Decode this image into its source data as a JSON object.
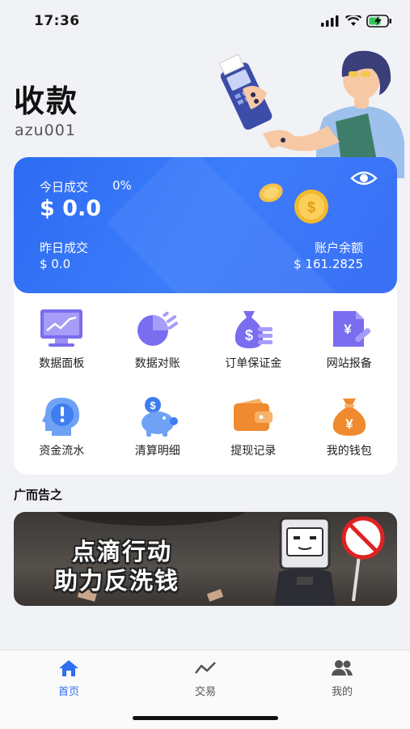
{
  "status_bar": {
    "time": "17:36"
  },
  "header": {
    "title": "收款",
    "username": "azu001"
  },
  "summary": {
    "today_label": "今日成交",
    "today_percent": "0%",
    "today_amount": "$ 0.0",
    "yesterday_label": "昨日成交",
    "yesterday_amount": "$ 0.0",
    "balance_label": "账户余额",
    "balance_amount": "$ 161.2825"
  },
  "menu": {
    "items": [
      {
        "label": "数据面板",
        "icon": "monitor-chart-icon"
      },
      {
        "label": "数据对账",
        "icon": "pie-chart-icon"
      },
      {
        "label": "订单保证金",
        "icon": "money-bag-icon"
      },
      {
        "label": "网站报备",
        "icon": "document-yen-icon"
      },
      {
        "label": "资金流水",
        "icon": "head-alert-icon"
      },
      {
        "label": "清算明细",
        "icon": "piggy-bank-icon"
      },
      {
        "label": "提现记录",
        "icon": "wallet-icon"
      },
      {
        "label": "我的钱包",
        "icon": "yen-bag-icon"
      }
    ]
  },
  "ads": {
    "title": "广而告之",
    "banner_line1": "点滴行动",
    "banner_line2": "助力反洗钱"
  },
  "tabs": [
    {
      "label": "首页",
      "icon": "home-icon",
      "active": true
    },
    {
      "label": "交易",
      "icon": "trend-icon",
      "active": false
    },
    {
      "label": "我的",
      "icon": "users-icon",
      "active": false
    }
  ],
  "colors": {
    "accent": "#2f6ef3",
    "card_start": "#2d6bf2",
    "card_end": "#3a6ff5"
  }
}
